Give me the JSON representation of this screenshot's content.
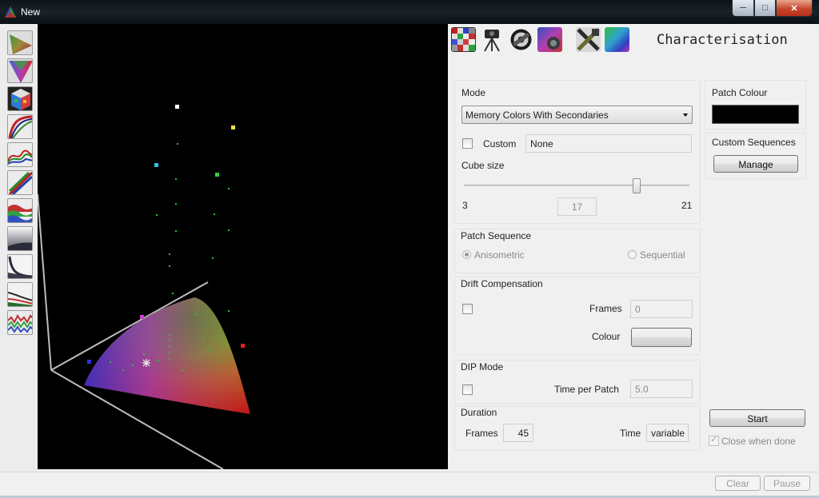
{
  "window": {
    "title": "New"
  },
  "panel": {
    "title": "Characterisation"
  },
  "mode": {
    "group_label": "Mode",
    "selected": "Memory Colors With Secondaries",
    "custom_label": "Custom",
    "custom_value": "None",
    "cube_size_label": "Cube size",
    "cube_min": "3",
    "cube_max": "21",
    "cube_value": "17"
  },
  "patch_colour": {
    "label": "Patch Colour",
    "color": "#000000"
  },
  "custom_sequences": {
    "label": "Custom Sequences",
    "manage_label": "Manage"
  },
  "patch_sequence": {
    "label": "Patch Sequence",
    "option_a": "Anisometric",
    "option_b": "Sequential"
  },
  "drift": {
    "label": "Drift Compensation",
    "frames_label": "Frames",
    "frames_value": "0",
    "colour_label": "Colour"
  },
  "dip": {
    "label": "DIP Mode",
    "time_label": "Time per Patch",
    "time_value": "5.0"
  },
  "duration": {
    "label": "Duration",
    "frames_label": "Frames",
    "frames_value": "45",
    "time_label": "Time",
    "time_value": "variable"
  },
  "actions": {
    "start_label": "Start",
    "close_when_done_label": "Close when done"
  },
  "status": {
    "clear_label": "Clear",
    "pause_label": "Pause"
  },
  "icons": {
    "left_tools": [
      "gamut-side-icon",
      "gamut-triangle-icon",
      "rgb-cube-icon",
      "tone-curve-icon",
      "spectrum-curve-icon",
      "rgb-ramp-icon",
      "spectral-bands-icon",
      "grey-ramp-icon",
      "grey-curve-icon",
      "grey-balance-icon",
      "spectrum-noise-icon"
    ],
    "toolbar": [
      "patch-grid-icon",
      "tripod-camera-icon",
      "film-reel-icon",
      "colour-wheel-icon",
      "tools-icon",
      "gamut-cube-icon"
    ]
  }
}
